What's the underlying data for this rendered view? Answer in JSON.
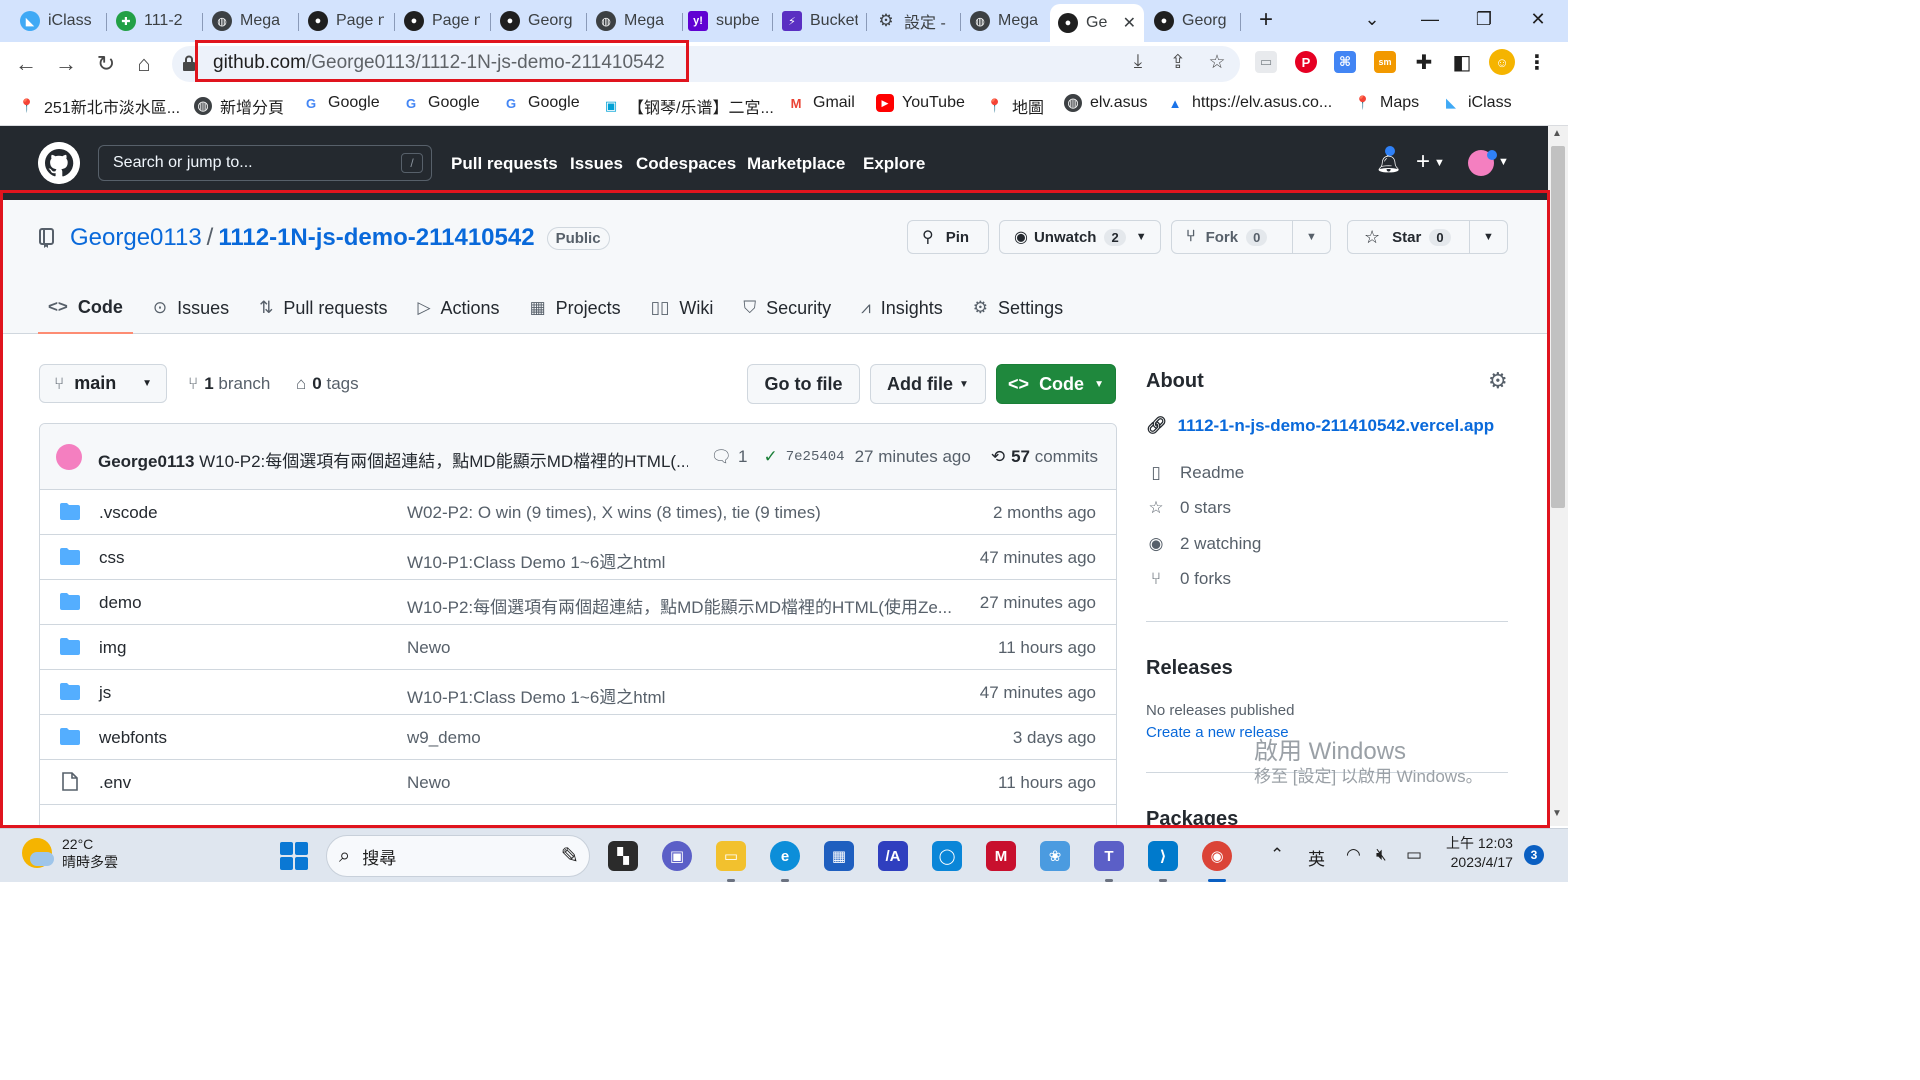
{
  "browser": {
    "tabs": [
      {
        "title": "iClass",
        "icon": "iclass-icon",
        "color": "#3fa9f5"
      },
      {
        "title": "111-2",
        "icon": "puzzle-icon",
        "color": "#22a046"
      },
      {
        "title": "Mega",
        "icon": "globe-icon",
        "color": "#3c4043"
      },
      {
        "title": "Page n",
        "icon": "github-icon",
        "color": "#1f1f1f"
      },
      {
        "title": "Page n",
        "icon": "github-icon",
        "color": "#1f1f1f"
      },
      {
        "title": "Georg",
        "icon": "github-icon",
        "color": "#1f1f1f"
      },
      {
        "title": "Mega",
        "icon": "globe-icon",
        "color": "#3c4043"
      },
      {
        "title": "supbe",
        "icon": "yahoo-icon",
        "color": "#6001d2"
      },
      {
        "title": "Bucket",
        "icon": "bucket-icon",
        "color": "#5a2fc2"
      },
      {
        "title": "設定 -",
        "icon": "gear-icon",
        "color": "#3c4043"
      },
      {
        "title": "Mega",
        "icon": "globe-icon",
        "color": "#3c4043"
      },
      {
        "title": "Ge",
        "icon": "github-icon",
        "color": "#1f1f1f"
      },
      {
        "title": "Georg",
        "icon": "github-icon",
        "color": "#1f1f1f"
      }
    ],
    "url_domain": "github.com",
    "url_path": "/George0113/1112-1N-js-demo-211410542",
    "bookmarks": [
      {
        "label": "251新北市淡水區...",
        "icon": "maps-pin-icon"
      },
      {
        "label": "新增分頁",
        "icon": "globe-icon"
      },
      {
        "label": "Google",
        "icon": "google-icon"
      },
      {
        "label": "Google",
        "icon": "google-icon"
      },
      {
        "label": "Google",
        "icon": "google-icon"
      },
      {
        "label": "【钢琴/乐谱】二宮...",
        "icon": "bilibili-icon"
      },
      {
        "label": "Gmail",
        "icon": "gmail-icon"
      },
      {
        "label": "YouTube",
        "icon": "youtube-icon"
      },
      {
        "label": "地圖",
        "icon": "maps-pin-icon"
      },
      {
        "label": "elv.asus",
        "icon": "globe-icon"
      },
      {
        "label": "https://elv.asus.co...",
        "icon": "asus-icon"
      },
      {
        "label": "Maps",
        "icon": "maps-pin-icon"
      },
      {
        "label": "iClass",
        "icon": "iclass-icon"
      }
    ]
  },
  "github": {
    "search_placeholder": "Search or jump to...",
    "search_shortcut": "/",
    "nav": [
      "Pull requests",
      "Issues",
      "Codespaces",
      "Marketplace",
      "Explore"
    ],
    "repo": {
      "owner": "George0113",
      "separator": "/",
      "name": "1112-1N-js-demo-211410542",
      "visibility": "Public",
      "pin_label": "Pin",
      "unwatch_label": "Unwatch",
      "watch_count": "2",
      "fork_label": "Fork",
      "fork_count": "0",
      "star_label": "Star",
      "star_count": "0"
    },
    "tabs": [
      {
        "label": "Code",
        "icon": "code-icon"
      },
      {
        "label": "Issues",
        "icon": "issue-icon"
      },
      {
        "label": "Pull requests",
        "icon": "pull-request-icon"
      },
      {
        "label": "Actions",
        "icon": "play-icon"
      },
      {
        "label": "Projects",
        "icon": "table-icon"
      },
      {
        "label": "Wiki",
        "icon": "book-icon"
      },
      {
        "label": "Security",
        "icon": "shield-icon"
      },
      {
        "label": "Insights",
        "icon": "graph-icon"
      },
      {
        "label": "Settings",
        "icon": "gear-icon"
      }
    ],
    "branch": "main",
    "branch_count": "1",
    "branch_word": "branch",
    "tag_count": "0",
    "tag_word": "tags",
    "go_to_file": "Go to file",
    "add_file": "Add file",
    "code_button": "Code",
    "last_commit": {
      "author": "George0113",
      "message": "W10-P2:每個選項有兩個超連結，點MD能顯示MD檔裡的HTML(...",
      "comments": "1",
      "sha": "7e25404",
      "time": "27 minutes ago",
      "commit_count": "57",
      "commit_word": "commits"
    },
    "files": [
      {
        "name": ".vscode",
        "type": "folder",
        "message": "W02-P2: O win (9 times), X wins (8 times), tie (9 times)",
        "time": "2 months ago"
      },
      {
        "name": "css",
        "type": "folder",
        "message": "W10-P1:Class Demo 1~6週之html",
        "time": "47 minutes ago"
      },
      {
        "name": "demo",
        "type": "folder",
        "message": "W10-P2:每個選項有兩個超連結，點MD能顯示MD檔裡的HTML(使用Ze...",
        "time": "27 minutes ago"
      },
      {
        "name": "img",
        "type": "folder",
        "message": "Newo",
        "time": "11 hours ago"
      },
      {
        "name": "js",
        "type": "folder",
        "message": "W10-P1:Class Demo 1~6週之html",
        "time": "47 minutes ago"
      },
      {
        "name": "webfonts",
        "type": "folder",
        "message": "w9_demo",
        "time": "3 days ago"
      },
      {
        "name": ".env",
        "type": "file",
        "message": "Newo",
        "time": "11 hours ago"
      }
    ],
    "about": {
      "title": "About",
      "link": "1112-1-n-js-demo-211410542.vercel.app",
      "readme": "Readme",
      "stars": "0 stars",
      "watching": "2 watching",
      "forks": "0 forks"
    },
    "releases": {
      "title": "Releases",
      "none": "No releases published",
      "create": "Create a new release"
    },
    "packages_title": "Packages"
  },
  "watermark": {
    "line1": "啟用 Windows",
    "line2": "移至 [設定] 以啟用 Windows。"
  },
  "taskbar": {
    "temperature": "22°C",
    "weather": "晴時多雲",
    "search_placeholder": "搜尋",
    "ime": "英",
    "time": "上午 12:03",
    "date": "2023/4/17",
    "notifications": "3"
  },
  "colors": {
    "accent_green": "#1f883d",
    "link_blue": "#0969da",
    "header_dark": "#24292f",
    "highlight_red": "#e0141e"
  }
}
